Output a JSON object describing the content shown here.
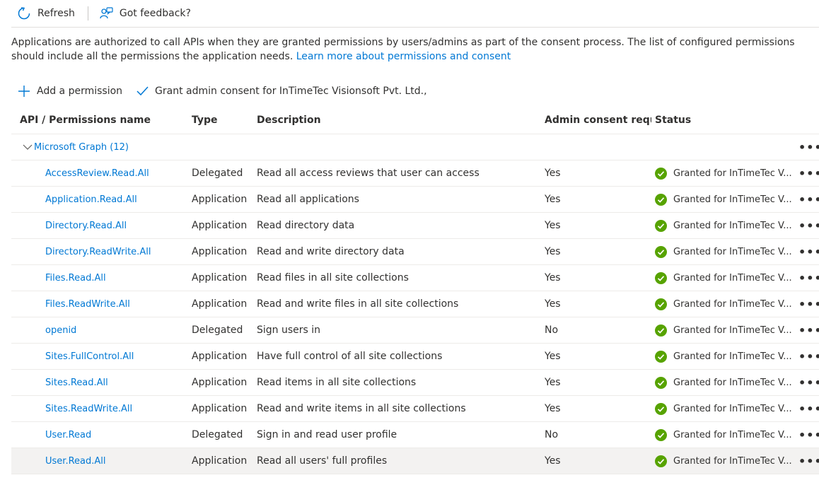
{
  "toolbar": {
    "refresh_label": "Refresh",
    "feedback_label": "Got feedback?"
  },
  "intro": {
    "text": "Applications are authorized to call APIs when they are granted permissions by users/admins as part of the consent process. The list of configured permissions should include all the permissions the application needs. ",
    "link": "Learn more about permissions and consent"
  },
  "actions": {
    "add_label": "Add a permission",
    "grant_label": "Grant admin consent for InTimeTec Visionsoft Pvt. Ltd.,"
  },
  "table": {
    "columns": [
      "API / Permissions name",
      "Type",
      "Description",
      "Admin consent requ...",
      "Status"
    ],
    "group": {
      "label": "Microsoft Graph (12)"
    },
    "rows": [
      {
        "name": "AccessReview.Read.All",
        "type": "Delegated",
        "description": "Read all access reviews that user can access",
        "admin": "Yes",
        "status": "Granted for InTimeTec V..."
      },
      {
        "name": "Application.Read.All",
        "type": "Application",
        "description": "Read all applications",
        "admin": "Yes",
        "status": "Granted for InTimeTec V..."
      },
      {
        "name": "Directory.Read.All",
        "type": "Application",
        "description": "Read directory data",
        "admin": "Yes",
        "status": "Granted for InTimeTec V..."
      },
      {
        "name": "Directory.ReadWrite.All",
        "type": "Application",
        "description": "Read and write directory data",
        "admin": "Yes",
        "status": "Granted for InTimeTec V..."
      },
      {
        "name": "Files.Read.All",
        "type": "Application",
        "description": "Read files in all site collections",
        "admin": "Yes",
        "status": "Granted for InTimeTec V..."
      },
      {
        "name": "Files.ReadWrite.All",
        "type": "Application",
        "description": "Read and write files in all site collections",
        "admin": "Yes",
        "status": "Granted for InTimeTec V..."
      },
      {
        "name": "openid",
        "type": "Delegated",
        "description": "Sign users in",
        "admin": "No",
        "status": "Granted for InTimeTec V..."
      },
      {
        "name": "Sites.FullControl.All",
        "type": "Application",
        "description": "Have full control of all site collections",
        "admin": "Yes",
        "status": "Granted for InTimeTec V..."
      },
      {
        "name": "Sites.Read.All",
        "type": "Application",
        "description": "Read items in all site collections",
        "admin": "Yes",
        "status": "Granted for InTimeTec V..."
      },
      {
        "name": "Sites.ReadWrite.All",
        "type": "Application",
        "description": "Read and write items in all site collections",
        "admin": "Yes",
        "status": "Granted for InTimeTec V..."
      },
      {
        "name": "User.Read",
        "type": "Delegated",
        "description": "Sign in and read user profile",
        "admin": "No",
        "status": "Granted for InTimeTec V..."
      },
      {
        "name": "User.Read.All",
        "type": "Application",
        "description": "Read all users' full profiles",
        "admin": "Yes",
        "status": "Granted for InTimeTec V..."
      }
    ],
    "more_glyph": "•••"
  },
  "colors": {
    "accent": "#0078d4",
    "granted": "#57a300",
    "selected_row": "#f3f2f1"
  },
  "icons": {
    "refresh": "refresh-icon",
    "feedback": "feedback-icon",
    "add": "plus-icon",
    "grant": "checkmark-icon",
    "status": "check-circle-icon",
    "group": "chevron-down-icon"
  }
}
